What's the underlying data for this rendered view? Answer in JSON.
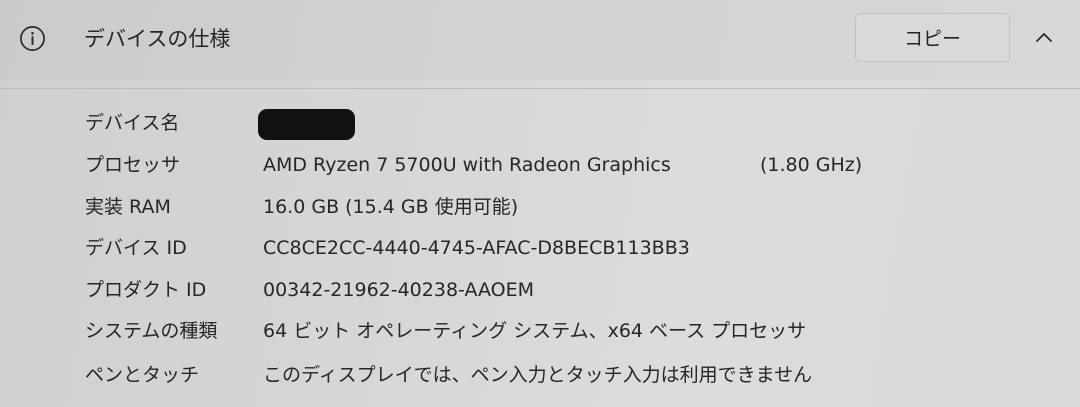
{
  "section": {
    "title": "デバイスの仕様",
    "copy_label": "コピー",
    "info_icon": "info-icon",
    "collapse_icon": "chevron-up-icon"
  },
  "specs": [
    {
      "label": "デバイス名",
      "value": "",
      "redacted": true
    },
    {
      "label": "プロセッサ",
      "value": "AMD Ryzen 7 5700U with Radeon Graphics",
      "extra": "(1.80 GHz)"
    },
    {
      "label": "実装 RAM",
      "value": "16.0 GB (15.4 GB 使用可能)"
    },
    {
      "label": "デバイス ID",
      "value": "CC8CE2CC-4440-4745-AFAC-D8BECB113BB3"
    },
    {
      "label": "プロダクト ID",
      "value": "00342-21962-40238-AAOEM"
    },
    {
      "label": "システムの種類",
      "value": "64 ビット オペレーティング システム、x64 ベース プロセッサ"
    },
    {
      "label": "ペンとタッチ",
      "value": "このディスプレイでは、ペン入力とタッチ入力は利用できません"
    }
  ]
}
